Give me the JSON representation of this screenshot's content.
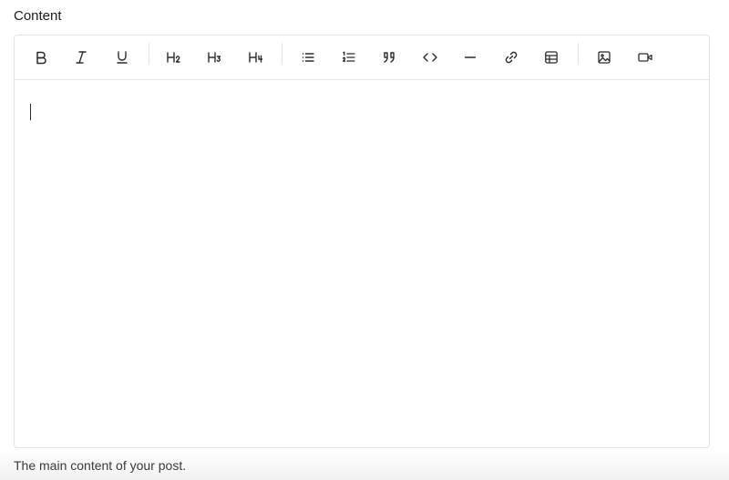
{
  "field": {
    "label": "Content",
    "helper_text": "The main content of your post."
  },
  "toolbar": {
    "buttons": [
      {
        "name": "bold",
        "icon": "bold-icon"
      },
      {
        "name": "italic",
        "icon": "italic-icon"
      },
      {
        "name": "underline",
        "icon": "underline-icon"
      },
      {
        "name": "heading-2",
        "icon": "heading-2-icon"
      },
      {
        "name": "heading-3",
        "icon": "heading-3-icon"
      },
      {
        "name": "heading-4",
        "icon": "heading-4-icon"
      },
      {
        "name": "bullet-list",
        "icon": "bullet-list-icon"
      },
      {
        "name": "numbered-list",
        "icon": "numbered-list-icon"
      },
      {
        "name": "blockquote",
        "icon": "quote-icon"
      },
      {
        "name": "code",
        "icon": "code-icon"
      },
      {
        "name": "horizontal-rule",
        "icon": "horizontal-rule-icon"
      },
      {
        "name": "link",
        "icon": "link-icon"
      },
      {
        "name": "table",
        "icon": "table-icon"
      },
      {
        "name": "image",
        "icon": "image-icon"
      },
      {
        "name": "video",
        "icon": "video-icon"
      }
    ]
  },
  "colors": {
    "border": "#e3e3e3",
    "icon": "#2b2b2b",
    "text": "#1f1f1f",
    "helper": "#3a3a3a"
  }
}
